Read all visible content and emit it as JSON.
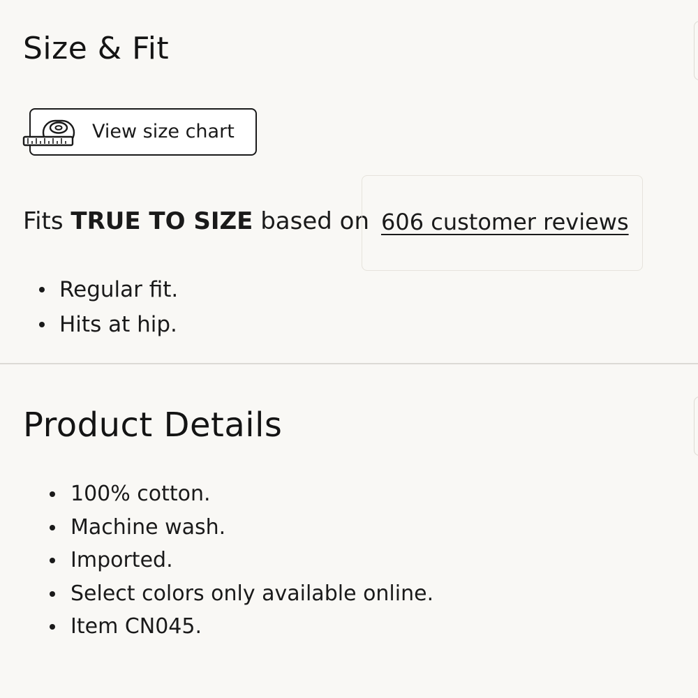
{
  "size_fit": {
    "title": "Size & Fit",
    "size_chart_label": "View size chart",
    "fits_prefix": "Fits",
    "fits_strong": "TRUE TO SIZE",
    "fits_suffix": "based on",
    "reviews_link": "606 customer reviews",
    "fit_notes": [
      "Regular fit.",
      "Hits at hip."
    ]
  },
  "product_details": {
    "title": "Product Details",
    "items": [
      "100% cotton.",
      "Machine wash.",
      "Imported.",
      "Select colors only available online.",
      "Item CN045."
    ]
  },
  "icons": {
    "size_chart_icon": "measuring-tape-icon"
  },
  "colors": {
    "background": "#f9f8f5",
    "text": "#1a1a1a",
    "divider": "#dcdad5"
  }
}
